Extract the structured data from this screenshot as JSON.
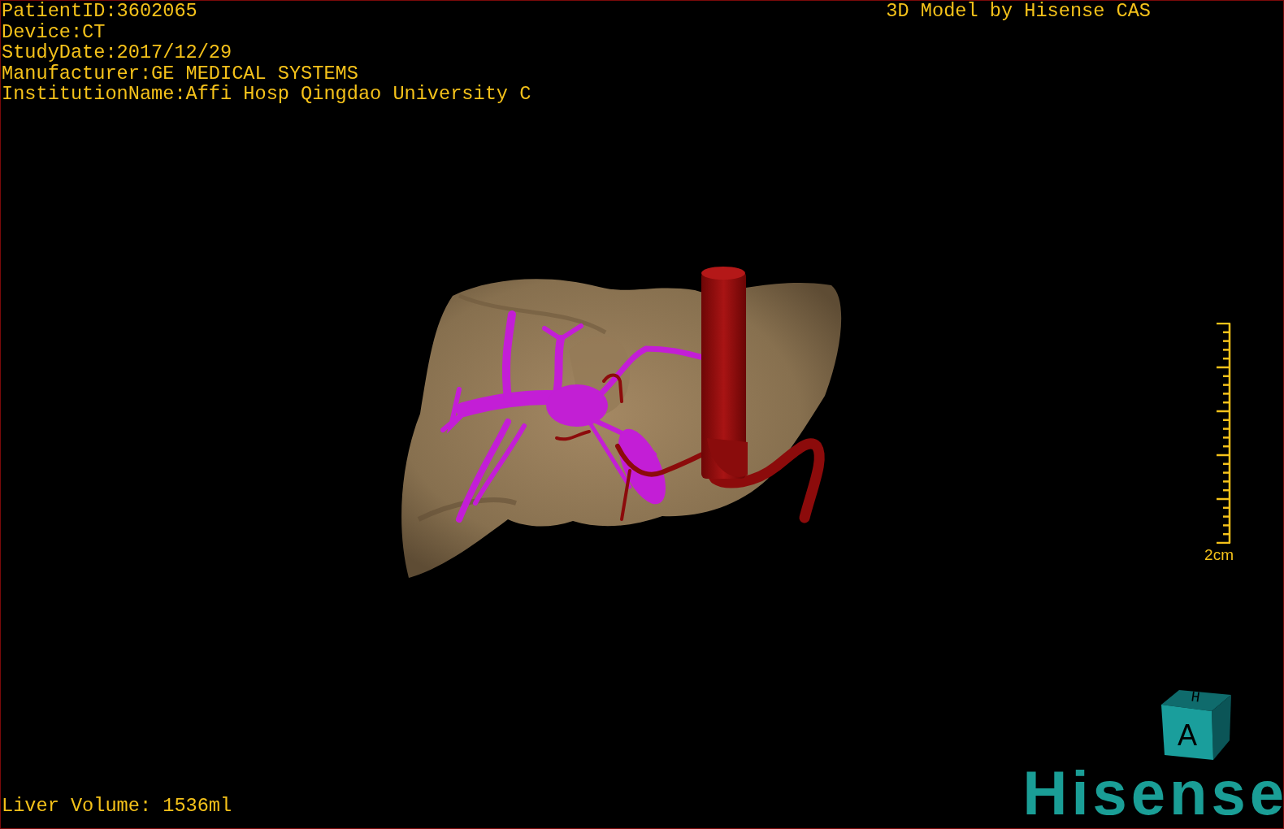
{
  "patient_info": [
    "PatientID:3602065",
    "Device:CT",
    "StudyDate:2017/12/29",
    "Manufacturer:GE MEDICAL SYSTEMS",
    "InstitutionName:Affi Hosp Qingdao University C"
  ],
  "title": "3D Model by Hisense CAS",
  "scale_bar": {
    "label": "2cm"
  },
  "liver_volume": "Liver Volume: 1536ml",
  "orientation_cube": {
    "top": "H",
    "front": "A"
  },
  "logo": "Hisense"
}
